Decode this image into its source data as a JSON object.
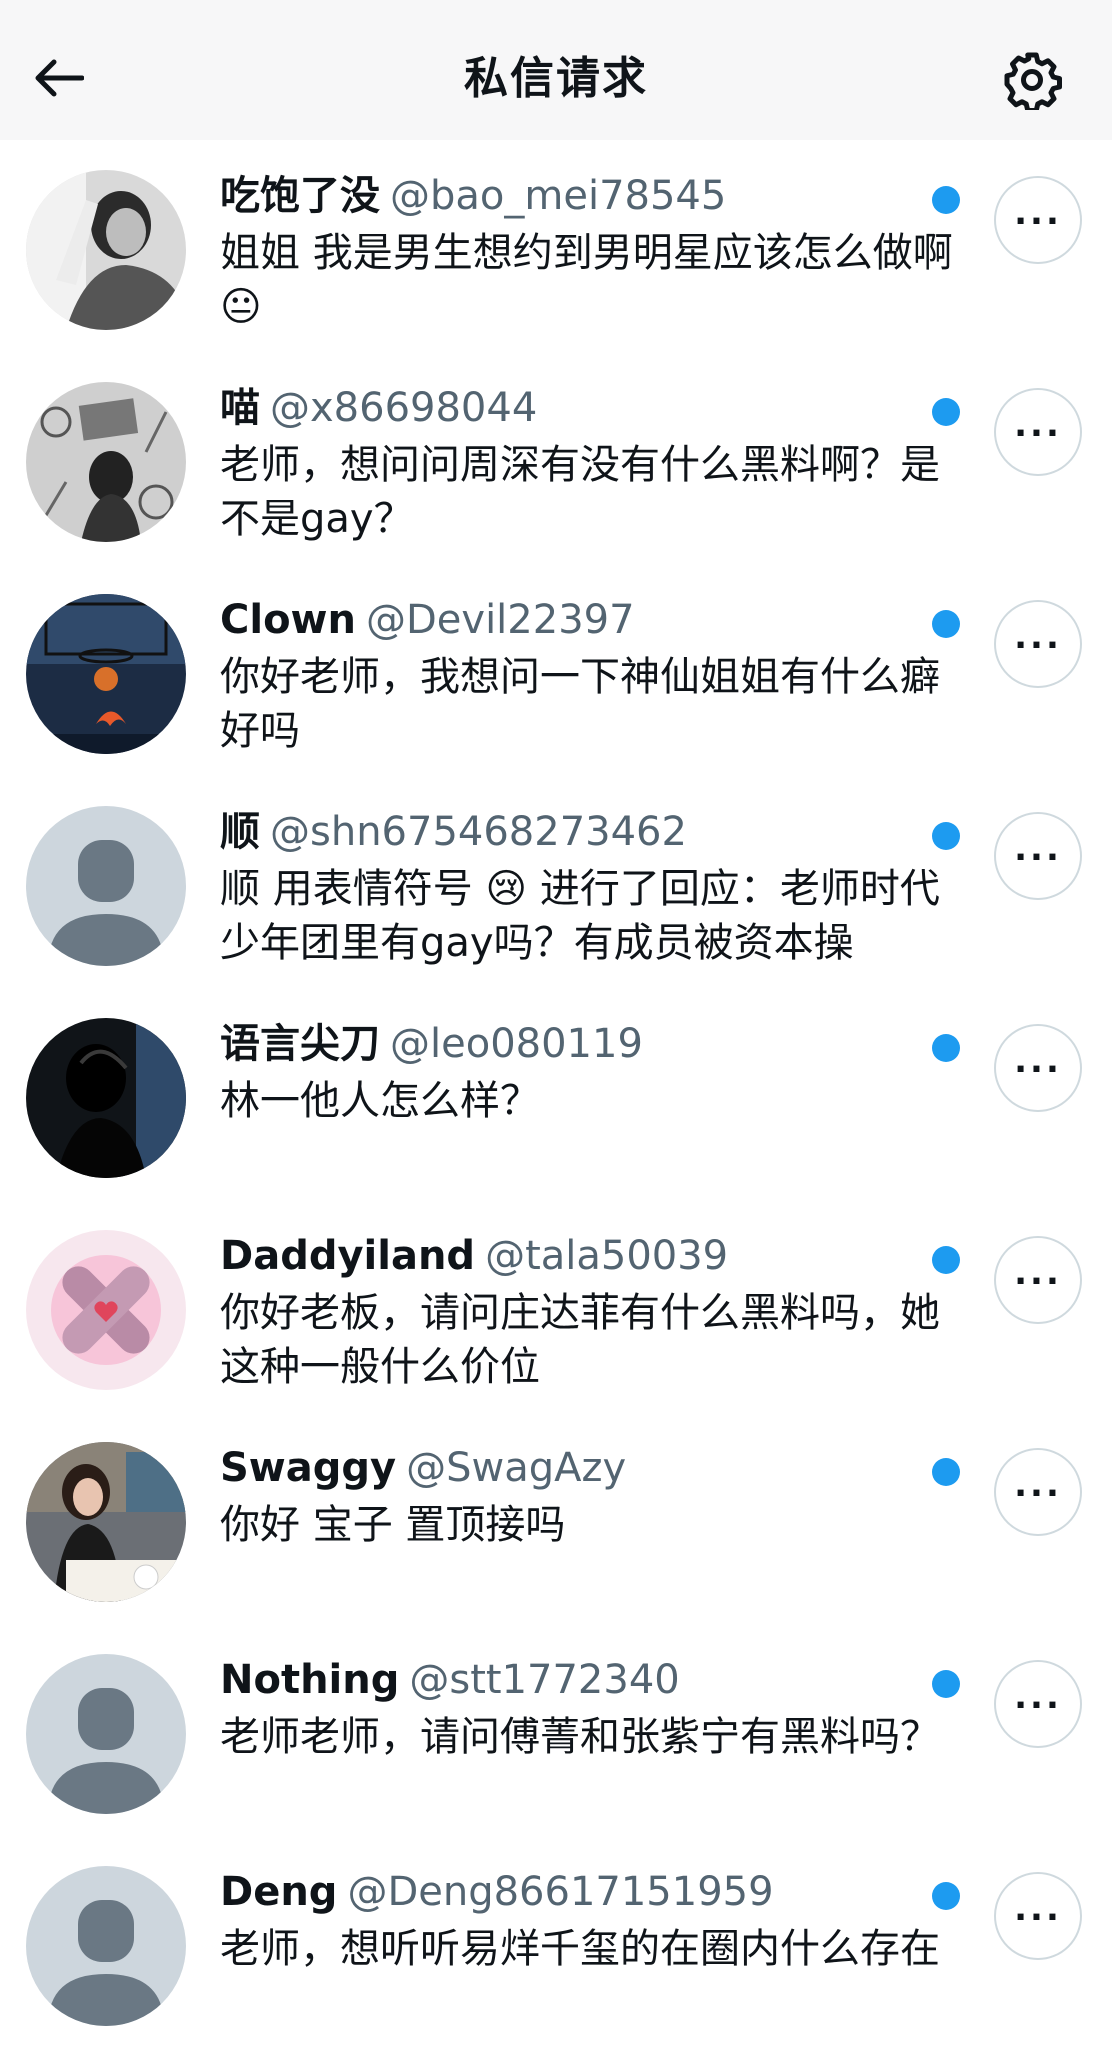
{
  "header": {
    "title": "私信请求"
  },
  "requests": [
    {
      "name": "吃饱了没",
      "handle": "@bao_mei78545",
      "message": "姐姐 我是男生想约到男明星应该怎么做啊😐",
      "avatar": "photo-person-bw"
    },
    {
      "name": "喵",
      "handle": "@x86698044",
      "message": "老师，想问问周深有没有什么黑料啊？是不是gay？",
      "avatar": "illustration-laptop"
    },
    {
      "name": "Clown",
      "handle": "@Devil22397",
      "message": "你好老师，我想问一下神仙姐姐有什么癖好吗",
      "avatar": "basketball-hoop-night"
    },
    {
      "name": "顺",
      "handle": "@shn675468273462",
      "message": "顺 用表情符号 😢 进行了回应：老师时代少年团里有gay吗？有成员被资本操",
      "avatar": "default-profile"
    },
    {
      "name": "语言尖刀",
      "handle": "@leo080119",
      "message": "林一他人怎么样？",
      "avatar": "silhouette-dark"
    },
    {
      "name": "Daddyiland",
      "handle": "@tala50039",
      "message": "你好老板，请问庄达菲有什么黑料吗，她这种一般什么价位",
      "avatar": "pink-bandage-heart"
    },
    {
      "name": "Swaggy",
      "handle": "@SwagAzy",
      "message": "你好 宝子 置顶接吗",
      "avatar": "photo-woman-restaurant"
    },
    {
      "name": "Nothing",
      "handle": "@stt1772340",
      "message": "老师老师，请问傅菁和张紫宁有黑料吗？",
      "avatar": "default-profile"
    },
    {
      "name": "Deng",
      "handle": "@Deng86617151959",
      "message": "老师，想听听易烊千玺的在圈内什么存在",
      "avatar": "default-profile"
    }
  ],
  "icons": {
    "back": "arrow-left-icon",
    "settings": "gear-icon",
    "more": "more-horizontal-icon",
    "unread": "unread-dot"
  },
  "colors": {
    "unread_dot": "#1d9bf0",
    "handle": "#536471",
    "text": "#0f1419",
    "header_bg": "#f7f7f8"
  }
}
